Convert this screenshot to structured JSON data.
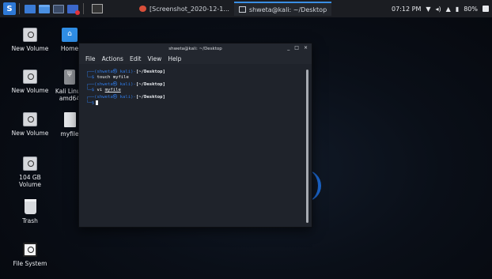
{
  "panel": {
    "menu_glyph": "S",
    "tasks": [
      {
        "label": "[Screenshot_2020-12-1..."
      },
      {
        "label": "shweta@kali: ~/Desktop"
      }
    ],
    "clock": "07:12 PM",
    "battery": "80%"
  },
  "desktop": {
    "icons": [
      {
        "label": "New Volume"
      },
      {
        "label": "Home"
      },
      {
        "label": "New Volume"
      },
      {
        "label": "Kali Linux amd64"
      },
      {
        "label": "New Volume"
      },
      {
        "label": "myfile"
      },
      {
        "label": "104 GB Volume"
      },
      {
        "label": "Trash"
      },
      {
        "label": "File System"
      }
    ]
  },
  "terminal": {
    "title": "shweta@kali: ~/Desktop",
    "controls": {
      "minimize": "_",
      "maximize": "□",
      "close": "×"
    },
    "menu": [
      "File",
      "Actions",
      "Edit",
      "View",
      "Help"
    ],
    "lines": [
      {
        "user": "(shweta㉿ kali)",
        "path": "[~/Desktop]",
        "cmd": "touch",
        "arg": "myfile"
      },
      {
        "user": "(shweta㉿ kali)",
        "path": "[~/Desktop]",
        "cmd": "vi",
        "arg": "myfile"
      },
      {
        "user": "(shweta㉿ kali)",
        "path": "[~/Desktop]",
        "cmd": "",
        "arg": ""
      }
    ]
  },
  "colors": {
    "accent": "#2f7ae5",
    "panel_bg": "#1b1d22",
    "terminal_bg": "#1f232b"
  }
}
